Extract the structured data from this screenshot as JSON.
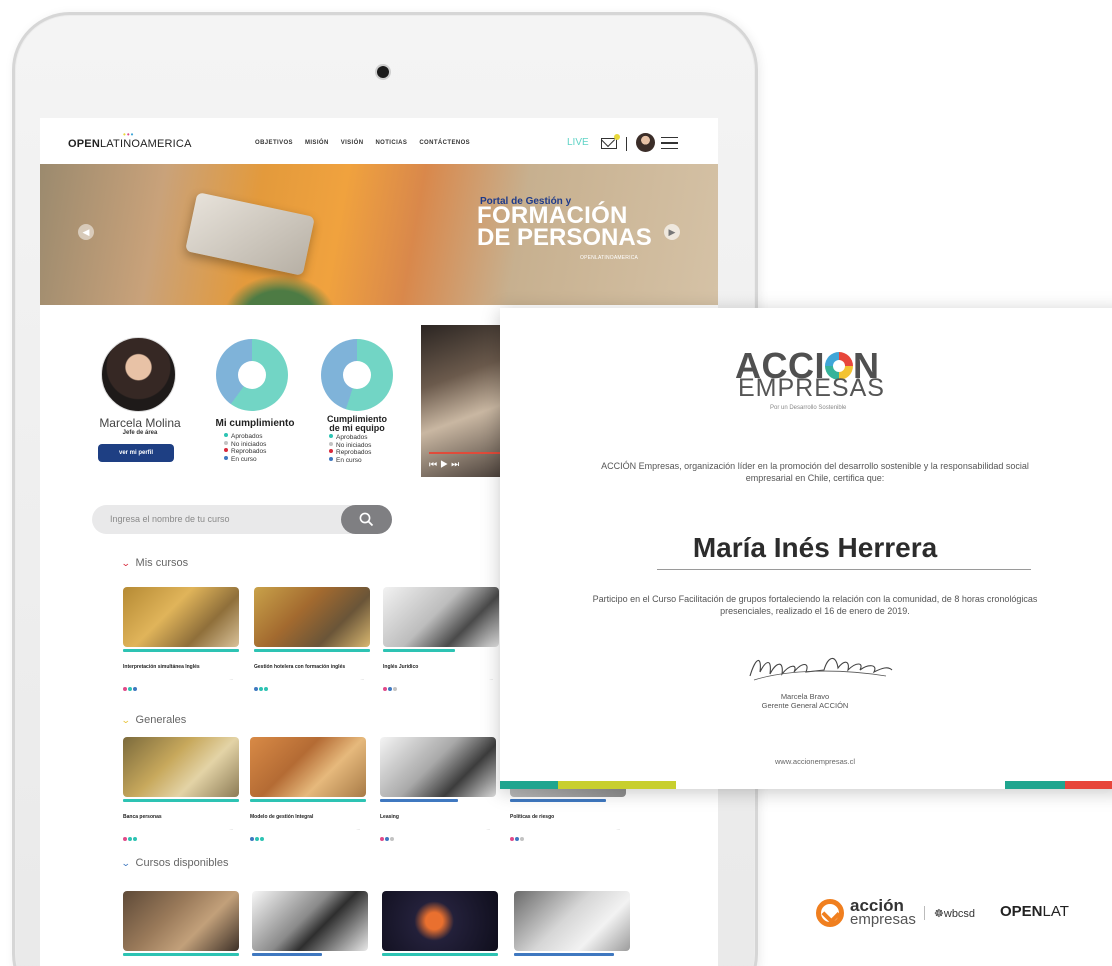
{
  "header": {
    "logo_bold": "OPEN",
    "logo_light": "LATINOAMERICA",
    "nav": [
      "OBJETIVOS",
      "MISIÓN",
      "VISIÓN",
      "NOTICIAS",
      "CONTÁCTENOS"
    ],
    "live": "LIVE"
  },
  "hero": {
    "kicker": "Portal de Gestión y",
    "title_1": "FORMACIÓN",
    "title_2": "DE PERSONAS",
    "brand": "OPENLATINOAMERICA"
  },
  "profile": {
    "name": "Marcela Molina",
    "role": "Jefe de área",
    "button": "ver mi perfil"
  },
  "stats": {
    "mine_title": "Mi cumplimiento",
    "team_title_1": "Cumplimiento",
    "team_title_2": "de mi equipo",
    "legend": [
      "Aprobados",
      "No iniciados",
      "Reprobados",
      "En curso"
    ],
    "legend_colors": [
      "#2dc3b3",
      "#c3c3c3",
      "#d8283a",
      "#3f78c0"
    ],
    "chart_colors": [
      "#72d5c5",
      "#7fb3d9"
    ]
  },
  "search": {
    "placeholder": "Ingresa el nombre de tu curso"
  },
  "sections": {
    "mis_cursos": "Mis cursos",
    "generales": "Generales",
    "disponibles": "Cursos disponibles"
  },
  "courses_mine": [
    "Interpretación simultánea Inglés",
    "Gestión hotelera con formación inglés",
    "Inglés Jurídico"
  ],
  "courses_general": [
    "Banca personas",
    "Modelo de gestión Integral",
    "Leasing",
    "Políticas de riesgo"
  ],
  "certificate": {
    "logo_1": "ACCI",
    "logo_1b": "N",
    "logo_2": "EMPRESAS",
    "logo_3": "Por un Desarrollo Sostenible",
    "intro": "ACCIÓN Empresas, organización líder en la promoción del desarrollo sostenible y la responsabilidad social empresarial en Chile, certifica que:",
    "recipient": "María Inés Herrera",
    "body": "Participo en el Curso Facilitación de grupos fortaleciendo la relación con la comunidad, de 8 horas cronológicas presenciales, realizado el 16 de enero de 2019.",
    "signer_name": "Marcela Bravo",
    "signer_title": "Gerente General ACCIÓN",
    "url": "www.accionempresas.cl"
  },
  "footer": {
    "accion_1": "acción",
    "accion_2": "empresas",
    "wbcsd": "wbcsd",
    "open_bold": "OPEN",
    "open_light": "LAT"
  }
}
